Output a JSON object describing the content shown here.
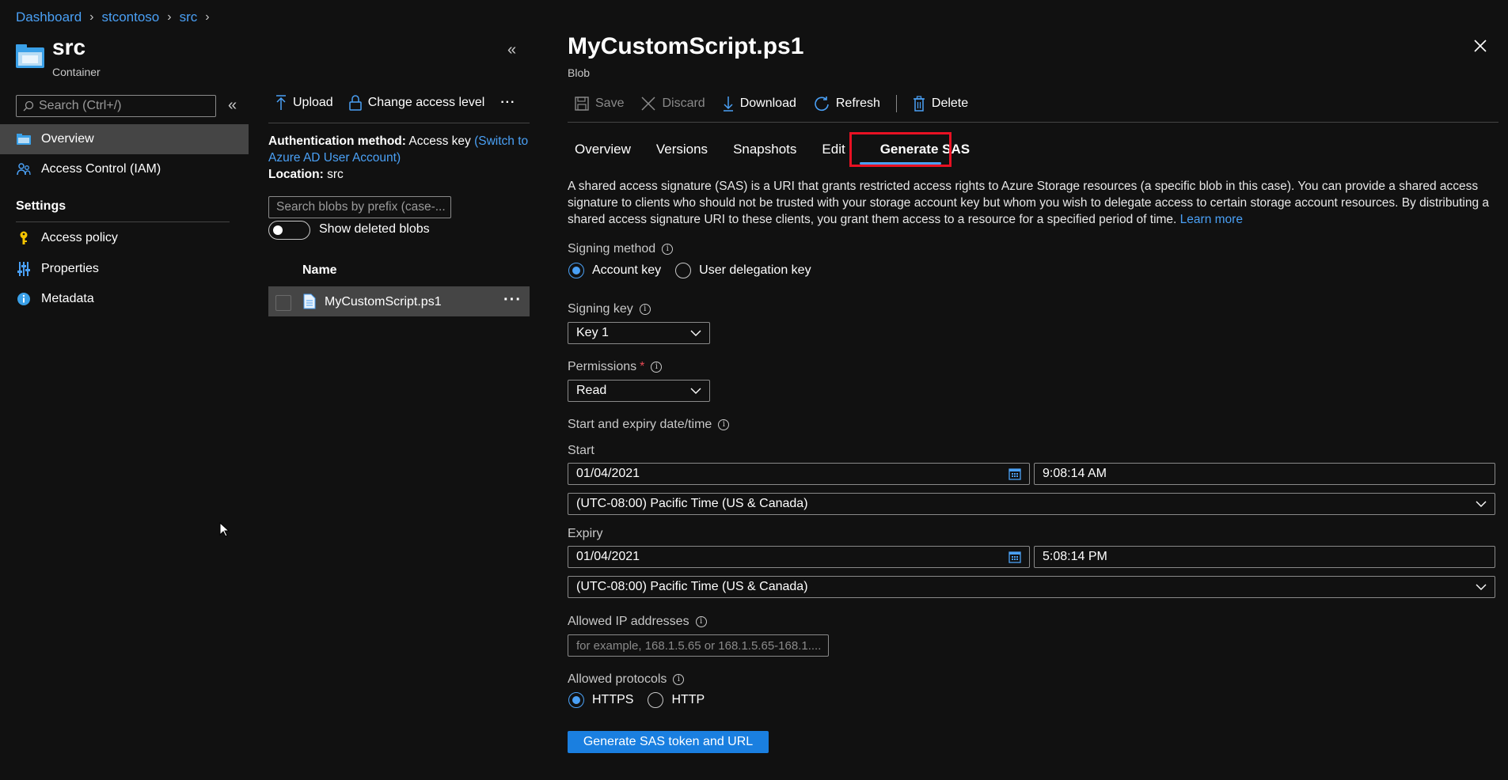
{
  "breadcrumb": [
    "Dashboard",
    "stcontoso",
    "src"
  ],
  "resource": {
    "title": "src",
    "subtitle": "Container"
  },
  "sidebar": {
    "search_placeholder": "Search (Ctrl+/)",
    "items": [
      {
        "label": "Overview",
        "icon": "container-icon"
      },
      {
        "label": "Access Control (IAM)",
        "icon": "people-icon"
      }
    ],
    "settings_heading": "Settings",
    "settings_items": [
      {
        "label": "Access policy",
        "icon": "key-icon"
      },
      {
        "label": "Properties",
        "icon": "sliders-icon"
      },
      {
        "label": "Metadata",
        "icon": "info-icon"
      }
    ]
  },
  "container": {
    "toolbar": {
      "upload": "Upload",
      "change_access": "Change access level",
      "more": "···"
    },
    "auth_label": "Authentication method:",
    "auth_value": "Access key",
    "auth_link": "(Switch to Azure AD User Account)",
    "location_label": "Location:",
    "location_value": "src",
    "blob_search_placeholder": "Search blobs by prefix (case-...",
    "show_deleted": "Show deleted blobs",
    "column_name": "Name",
    "blobs": [
      {
        "name": "MyCustomScript.ps1",
        "more": "···"
      }
    ]
  },
  "panel": {
    "title": "MyCustomScript.ps1",
    "subtitle": "Blob",
    "toolbar": {
      "save": "Save",
      "discard": "Discard",
      "download": "Download",
      "refresh": "Refresh",
      "delete": "Delete"
    },
    "tabs": [
      "Overview",
      "Versions",
      "Snapshots",
      "Edit",
      "Generate SAS"
    ],
    "active_tab": "Generate SAS",
    "description": "A shared access signature (SAS) is a URI that grants restricted access rights to Azure Storage resources (a specific blob in this case). You can provide a shared access signature to clients who should not be trusted with your storage account key but whom you wish to delegate access to certain storage account resources. By distributing a shared access signature URI to these clients, you grant them access to a resource for a specified period of time.",
    "learn_more": "Learn more",
    "signing_method": {
      "label": "Signing method",
      "options": [
        "Account key",
        "User delegation key"
      ],
      "selected": "Account key"
    },
    "signing_key": {
      "label": "Signing key",
      "value": "Key 1"
    },
    "permissions": {
      "label": "Permissions",
      "required": "*",
      "value": "Read"
    },
    "dates_label": "Start and expiry date/time",
    "start": {
      "label": "Start",
      "date": "01/04/2021",
      "time": "9:08:14 AM",
      "timezone": "(UTC-08:00) Pacific Time (US & Canada)"
    },
    "expiry": {
      "label": "Expiry",
      "date": "01/04/2021",
      "time": "5:08:14 PM",
      "timezone": "(UTC-08:00) Pacific Time (US & Canada)"
    },
    "allowed_ip": {
      "label": "Allowed IP addresses",
      "placeholder": "for example, 168.1.5.65 or 168.1.5.65-168.1...."
    },
    "protocols": {
      "label": "Allowed protocols",
      "options": [
        "HTTPS",
        "HTTP"
      ],
      "selected": "HTTPS"
    },
    "generate_button": "Generate SAS token and URL"
  },
  "colors": {
    "accent": "#4aa0f5",
    "button": "#1a7fe0",
    "highlight_border": "#e81123",
    "background": "#111111"
  }
}
